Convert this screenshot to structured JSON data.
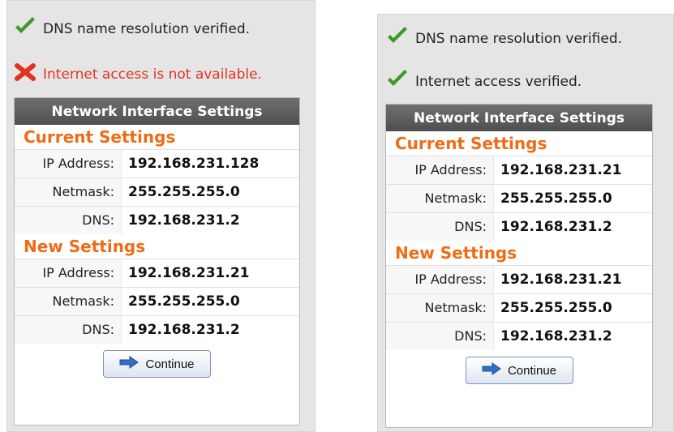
{
  "left": {
    "status_dns": "DNS name resolution verified.",
    "status_internet": "Internet access is not available.",
    "card_title": "Network Interface Settings",
    "current_title": "Current Settings",
    "current": [
      {
        "label": "IP Address:",
        "value": "192.168.231.128"
      },
      {
        "label": "Netmask:",
        "value": "255.255.255.0"
      },
      {
        "label": "DNS:",
        "value": "192.168.231.2"
      }
    ],
    "new_title": "New Settings",
    "new": [
      {
        "label": "IP Address:",
        "value": "192.168.231.21"
      },
      {
        "label": "Netmask:",
        "value": "255.255.255.0"
      },
      {
        "label": "DNS:",
        "value": "192.168.231.2"
      }
    ],
    "continue_label": "Continue"
  },
  "right": {
    "status_dns": "DNS name resolution verified.",
    "status_internet": "Internet access verified.",
    "card_title": "Network Interface Settings",
    "current_title": "Current Settings",
    "current": [
      {
        "label": "IP Address:",
        "value": "192.168.231.21"
      },
      {
        "label": "Netmask:",
        "value": "255.255.255.0"
      },
      {
        "label": "DNS:",
        "value": "192.168.231.2"
      }
    ],
    "new_title": "New Settings",
    "new": [
      {
        "label": "IP Address:",
        "value": "192.168.231.21"
      },
      {
        "label": "Netmask:",
        "value": "255.255.255.0"
      },
      {
        "label": "DNS:",
        "value": "192.168.231.2"
      }
    ],
    "continue_label": "Continue"
  },
  "colors": {
    "accent_orange": "#ef6c16",
    "error_red": "#e03421",
    "check_green": "#3c9a2a",
    "header_gray": "#5c5c5c"
  },
  "icons": {
    "ok": "checkmark-icon",
    "error": "x-icon",
    "continue": "arrow-right-icon"
  }
}
